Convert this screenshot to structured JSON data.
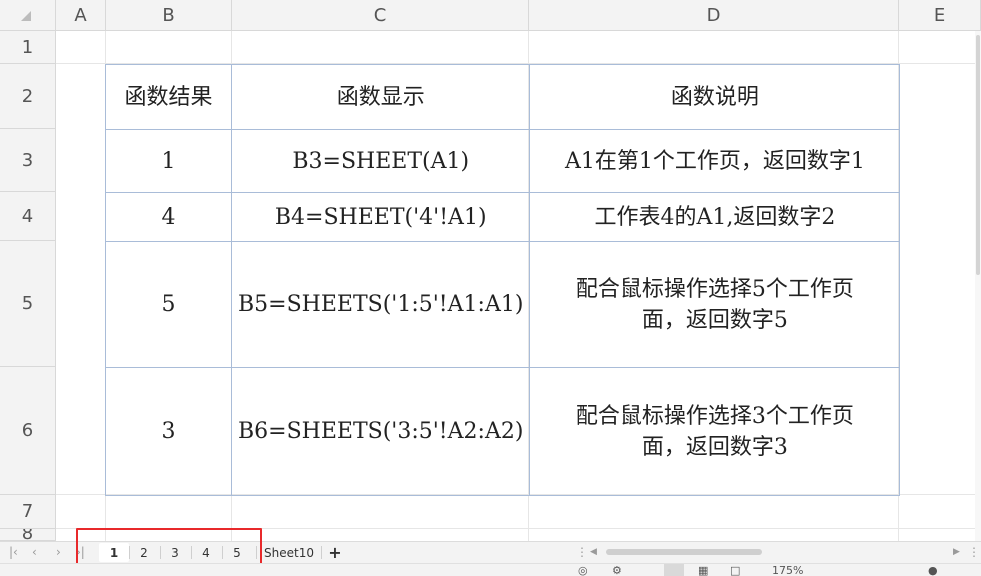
{
  "columns": [
    "A",
    "B",
    "C",
    "D",
    "E"
  ],
  "rows": [
    "1",
    "2",
    "3",
    "4",
    "5",
    "6",
    "7",
    "8"
  ],
  "table": {
    "header": [
      "函数结果",
      "函数显示",
      "函数说明"
    ],
    "rows": [
      {
        "result": "1",
        "formula": "B3=SHEET(A1)",
        "desc1": "A1在第1个工作页，返回数字1",
        "desc2": ""
      },
      {
        "result": "4",
        "formula": "B4=SHEET('4'!A1)",
        "desc1": "工作表4的A1,返回数字2",
        "desc2": ""
      },
      {
        "result": "5",
        "formula": "B5=SHEETS('1:5'!A1:A1)",
        "desc1": "配合鼠标操作选择5个工作页",
        "desc2": "面，返回数字5"
      },
      {
        "result": "3",
        "formula": "B6=SHEETS('3:5'!A2:A2)",
        "desc1": "配合鼠标操作选择3个工作页",
        "desc2": "面，返回数字3"
      }
    ]
  },
  "tabs": {
    "sheets": [
      "1",
      "2",
      "3",
      "4",
      "5",
      "Sheet10"
    ],
    "active": "1",
    "add": "+"
  },
  "status": {
    "zoom": "175%"
  },
  "colors": {
    "highlight": "#e8292b",
    "table_border": "#a9bcd8",
    "header_bg": "#f3f3f3"
  }
}
